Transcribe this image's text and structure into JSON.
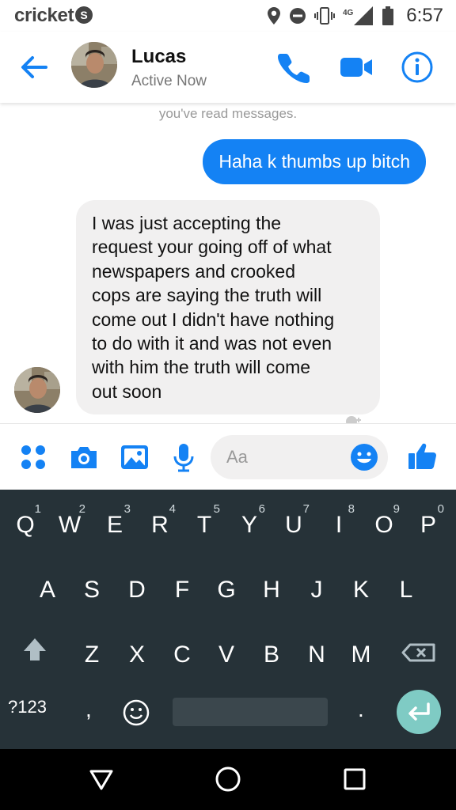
{
  "status_bar": {
    "carrier": "cricket",
    "carrier_badge": "S",
    "network": "4G",
    "time": "6:57",
    "icons": [
      "location-icon",
      "do-not-disturb-icon",
      "vibrate-icon",
      "signal-icon",
      "battery-icon"
    ]
  },
  "header": {
    "name": "Lucas",
    "status": "Active Now",
    "icons": [
      "back-arrow-icon",
      "phone-icon",
      "video-camera-icon",
      "info-icon"
    ],
    "accent": "#1482f4"
  },
  "conversation": {
    "read_note": "you've read messages.",
    "outgoing": "Haha k thumbs up bitch",
    "incoming": "I was just accepting  the\nrequest your going off of what\nnewspapers and crooked\ncops are saying the truth will\ncome out I didn't have nothing\nto do with it and was not even\nwith him the truth will come\nout soon",
    "outgoing_color": "#1482f4",
    "incoming_color": "#f1f0f0"
  },
  "composer": {
    "placeholder": "Aa",
    "icons": [
      "more-icon",
      "camera-icon",
      "gallery-icon",
      "mic-icon",
      "emoji-icon",
      "thumbs-up-icon"
    ]
  },
  "keyboard": {
    "row1": [
      {
        "key": "Q",
        "hint": "1"
      },
      {
        "key": "W",
        "hint": "2"
      },
      {
        "key": "E",
        "hint": "3"
      },
      {
        "key": "R",
        "hint": "4"
      },
      {
        "key": "T",
        "hint": "5"
      },
      {
        "key": "Y",
        "hint": "6"
      },
      {
        "key": "U",
        "hint": "7"
      },
      {
        "key": "I",
        "hint": "8"
      },
      {
        "key": "O",
        "hint": "9"
      },
      {
        "key": "P",
        "hint": "0"
      }
    ],
    "row2": [
      "A",
      "S",
      "D",
      "F",
      "G",
      "H",
      "J",
      "K",
      "L"
    ],
    "row3": [
      "Z",
      "X",
      "C",
      "V",
      "B",
      "N",
      "M"
    ],
    "symbols": "?123",
    "comma": ",",
    "period": ".",
    "background": "#263238",
    "enter_color": "#7fcbc4"
  },
  "nav_bar": {
    "icons": [
      "back-triangle-icon",
      "home-circle-icon",
      "recents-square-icon"
    ]
  }
}
